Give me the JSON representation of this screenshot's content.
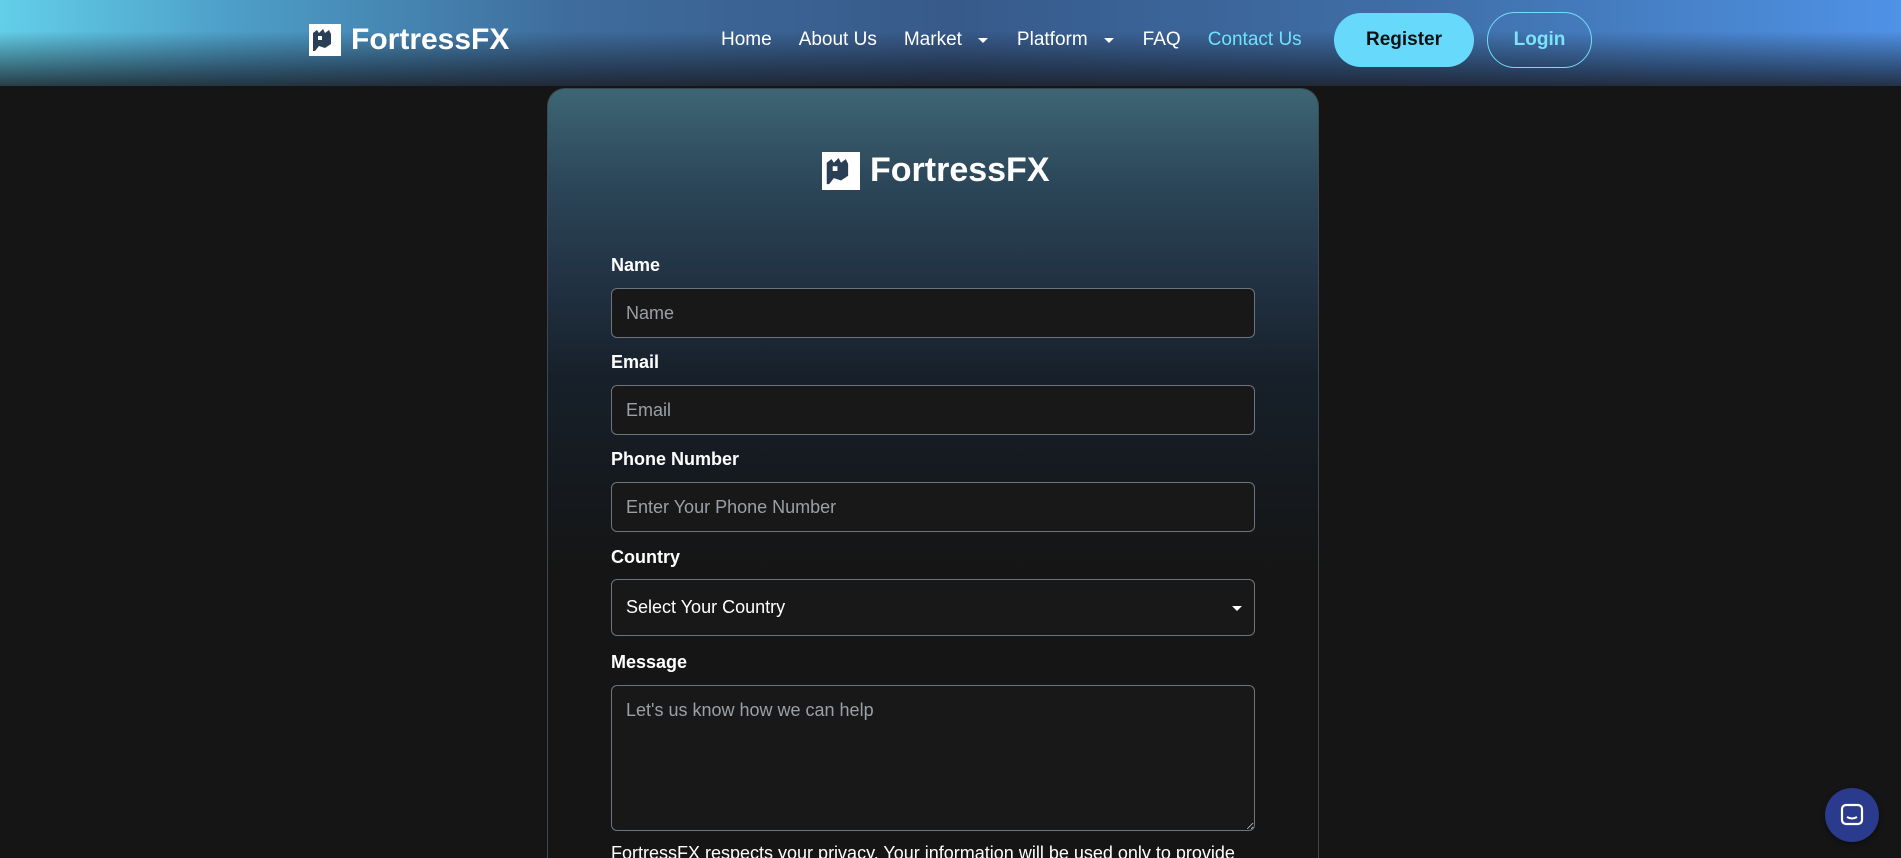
{
  "brand": {
    "name": "FortressFX"
  },
  "nav": {
    "items": [
      {
        "label": "Home"
      },
      {
        "label": "About Us"
      },
      {
        "label": "Market",
        "dropdown": true
      },
      {
        "label": "Platform",
        "dropdown": true
      },
      {
        "label": "FAQ"
      },
      {
        "label": "Contact Us",
        "active": true
      }
    ],
    "register_label": "Register",
    "login_label": "Login"
  },
  "form": {
    "name": {
      "label": "Name",
      "placeholder": "Name"
    },
    "email": {
      "label": "Email",
      "placeholder": "Email"
    },
    "phone": {
      "label": "Phone Number",
      "placeholder": "Enter Your Phone Number"
    },
    "country": {
      "label": "Country",
      "selected": "Select Your Country"
    },
    "message": {
      "label": "Message",
      "placeholder": "Let's us know how we can help"
    },
    "privacy_text": "FortressFX respects your privacy. Your information will be used only to provide"
  },
  "colors": {
    "accent": "#67dafb",
    "active_nav": "#6ee2fb",
    "background": "#151515",
    "chat_button": "#2a3a8c"
  },
  "icons": {
    "brand": "fortress-logo-icon",
    "dropdown": "chevron-down-icon",
    "chat": "chat-bubble-icon"
  }
}
